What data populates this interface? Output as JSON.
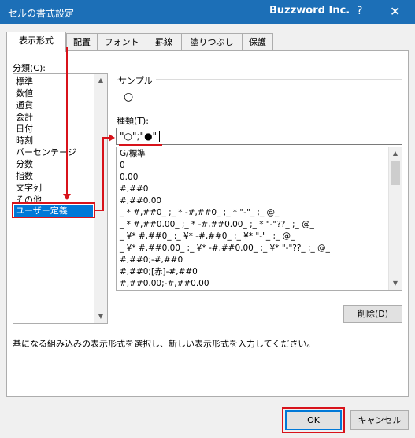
{
  "window": {
    "title": "セルの書式設定",
    "brand": "Buzzword Inc.",
    "help_label": "?",
    "close_label": "✕"
  },
  "tabs": [
    {
      "label": "表示形式",
      "active": true
    },
    {
      "label": "配置"
    },
    {
      "label": "フォント"
    },
    {
      "label": "罫線"
    },
    {
      "label": "塗りつぶし"
    },
    {
      "label": "保護"
    }
  ],
  "category": {
    "label": "分類(C):",
    "items": [
      "標準",
      "数値",
      "通貨",
      "会計",
      "日付",
      "時刻",
      "パーセンテージ",
      "分数",
      "指数",
      "文字列",
      "その他",
      "ユーザー定義"
    ],
    "selected": "ユーザー定義"
  },
  "sample": {
    "label": "サンプル",
    "value": "○"
  },
  "type": {
    "label": "種類(T):",
    "value": "\"○\";\"●\""
  },
  "formats": [
    "G/標準",
    "0",
    "0.00",
    "#,##0",
    "#,##0.00",
    "_ * #,##0_ ;_ * -#,##0_ ;_ * \"-\"_ ;_ @_",
    "_ * #,##0.00_ ;_ * -#,##0.00_ ;_ * \"-\"??_ ;_ @_",
    "_ ¥* #,##0_ ;_ ¥* -#,##0_ ;_ ¥* \"-\"_ ;_ @_",
    "_ ¥* #,##0.00_ ;_ ¥* -#,##0.00_ ;_ ¥* \"-\"??_ ;_ @_",
    "#,##0;-#,##0",
    "#,##0;[赤]-#,##0",
    "#,##0.00;-#,##0.00"
  ],
  "delete_button": "削除(D)",
  "description": "基になる組み込みの表示形式を選択し、新しい表示形式を入力してください。",
  "ok_button": "OK",
  "cancel_button": "キャンセル",
  "colors": {
    "titlebar": "#1c6fb7",
    "selection": "#0078d7",
    "annotation_red": "#d8131b"
  }
}
